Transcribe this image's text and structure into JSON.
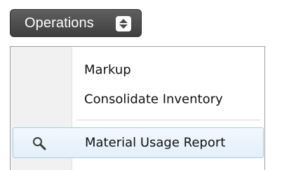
{
  "operations_button": {
    "label": "Operations",
    "icon": "up-down-spinner-icon"
  },
  "menu": {
    "items": [
      {
        "label": "Markup",
        "icon": null,
        "highlighted": false
      },
      {
        "label": "Consolidate Inventory",
        "icon": null,
        "highlighted": false
      },
      {
        "label": "Material Usage Report",
        "icon": "magnifier-icon",
        "highlighted": true
      }
    ]
  },
  "colors": {
    "button_bg": "#4f4f4f",
    "button_text": "#ffffff",
    "menu_gutter": "#f1f1f1",
    "highlight_bg": "#e8f2fd",
    "highlight_border": "#aac8e8"
  }
}
